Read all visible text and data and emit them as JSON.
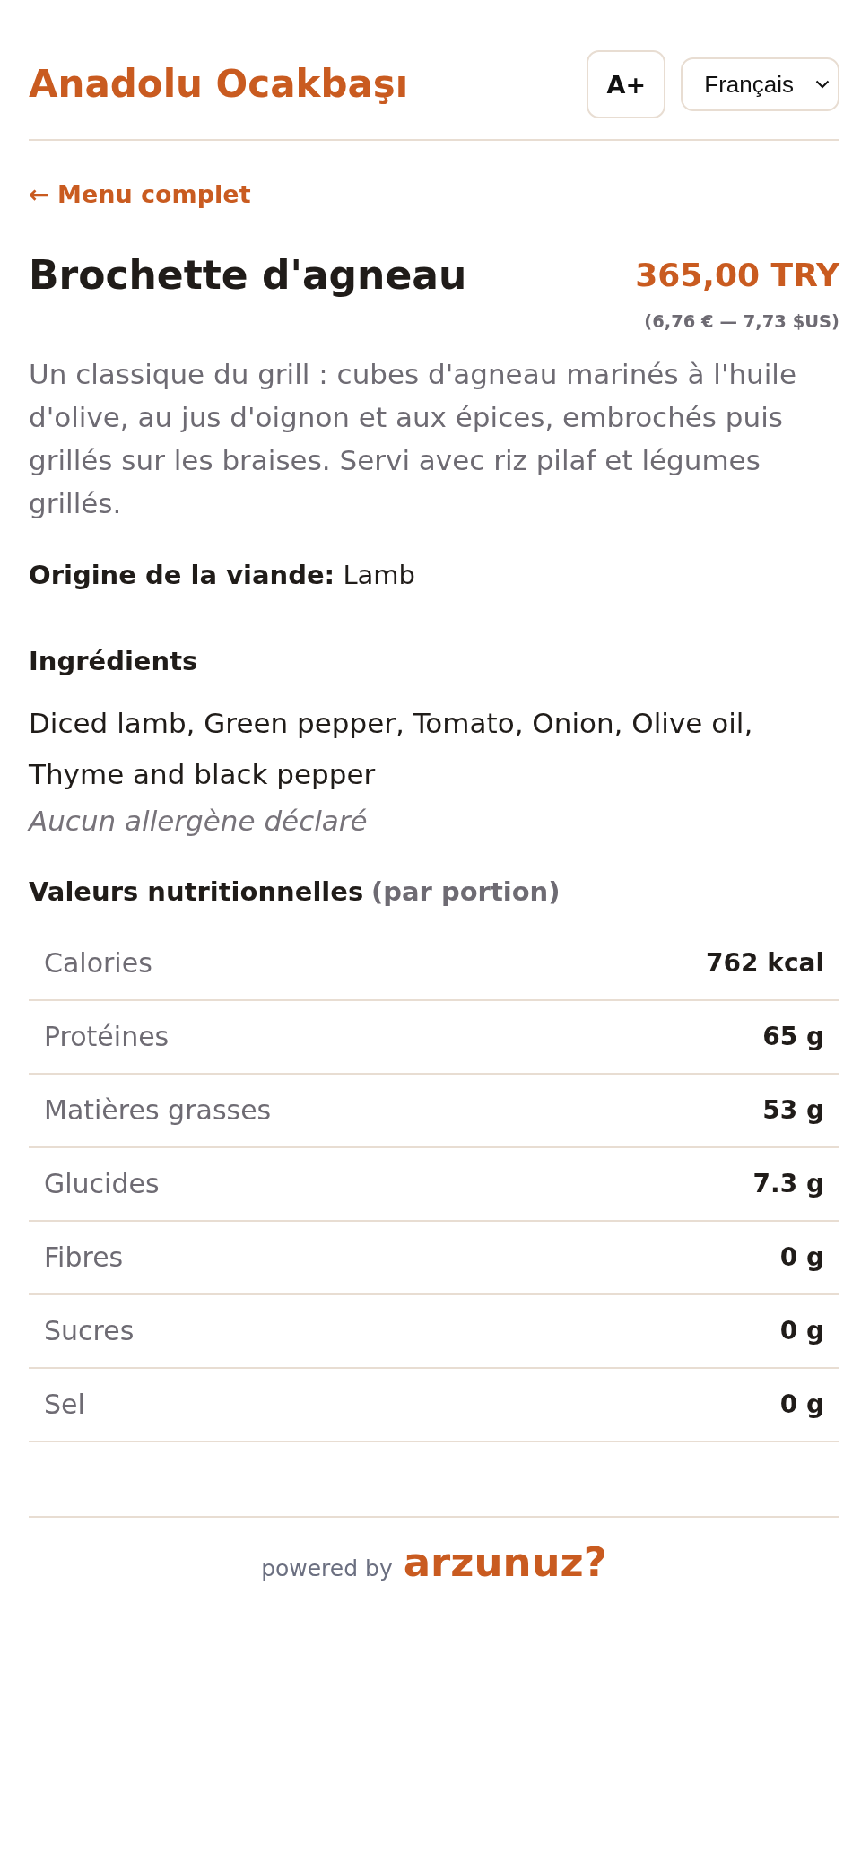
{
  "header": {
    "restaurant_name": "Anadolu Ocakbaşı",
    "font_size_button": "A+",
    "language_select": {
      "value": "Français"
    }
  },
  "back_link": "← Menu complet",
  "dish": {
    "name": "Brochette d'agneau",
    "price": "365,00 TRY",
    "converted_price": "(6,76 € — 7,73 $US)",
    "description": "Un classique du grill : cubes d'agneau marinés à l'huile d'olive, au jus d'oignon et aux épices, embrochés puis grillés sur les braises. Servi avec riz pilaf et légumes grillés.",
    "meat_origin": "**Origine de la viande:** Lamb"
  },
  "ingredients": {
    "heading": "Ingrédients",
    "list": "Diced lamb, Green pepper, Tomato, Onion, Olive oil, Thyme and black pepper",
    "allergens": "Aucun allergène déclaré"
  },
  "nutrition": {
    "heading": "Valeurs nutritionnelles",
    "note": "(par portion)",
    "rows": [
      {
        "label": "Calories",
        "value": "762 kcal"
      },
      {
        "label": "Protéines",
        "value": "65 g"
      },
      {
        "label": "Matières grasses",
        "value": "53 g"
      },
      {
        "label": "Glucides",
        "value": "7.3 g"
      },
      {
        "label": "Fibres",
        "value": "0 g"
      },
      {
        "label": "Sucres",
        "value": "0 g"
      },
      {
        "label": "Sel",
        "value": "0 g"
      }
    ]
  },
  "footer": {
    "powered_by": "powered by",
    "brand": "arzunuz?"
  }
}
